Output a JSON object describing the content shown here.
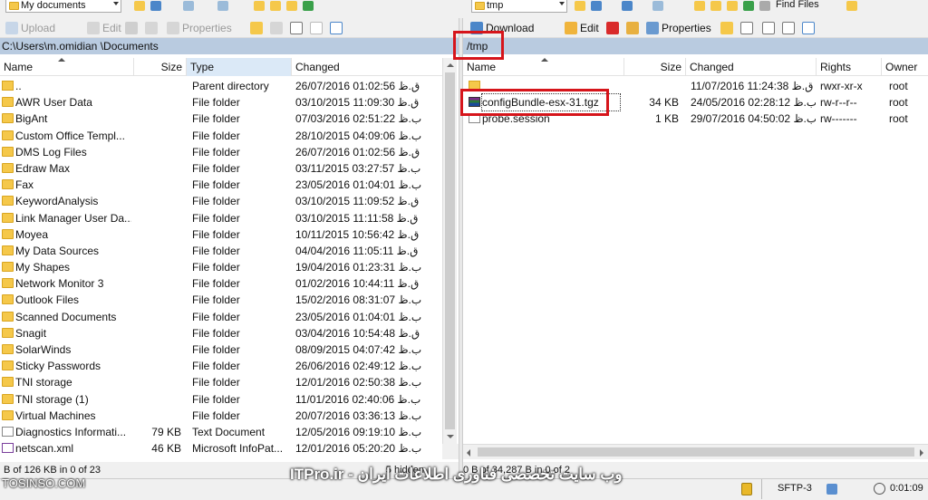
{
  "left_panel": {
    "drive_combo": "My documents",
    "toolbar": {
      "upload": "Upload",
      "edit": "Edit",
      "properties": "Properties"
    },
    "path": "C:\\Users\\m.omidian        \\Documents",
    "columns": {
      "name": "Name",
      "size": "Size",
      "type": "Type",
      "changed": "Changed"
    },
    "rows": [
      {
        "name": "..",
        "size": "",
        "type": "Parent directory",
        "changed": "26/07/2016 01:02:56 ق.ظ",
        "icon": "up-icon"
      },
      {
        "name": "AWR User Data",
        "size": "",
        "type": "File folder",
        "changed": "03/10/2015 11:09:30 ق.ظ",
        "icon": "folder-icon"
      },
      {
        "name": "BigAnt",
        "size": "",
        "type": "File folder",
        "changed": "07/03/2016 02:51:22 ب.ظ",
        "icon": "folder-icon"
      },
      {
        "name": "Custom Office Templ...",
        "size": "",
        "type": "File folder",
        "changed": "28/10/2015 04:09:06 ب.ظ",
        "icon": "folder-icon"
      },
      {
        "name": "DMS Log Files",
        "size": "",
        "type": "File folder",
        "changed": "26/07/2016 01:02:56 ق.ظ",
        "icon": "folder-icon"
      },
      {
        "name": "Edraw Max",
        "size": "",
        "type": "File folder",
        "changed": "03/11/2015 03:27:57 ب.ظ",
        "icon": "folder-icon"
      },
      {
        "name": "Fax",
        "size": "",
        "type": "File folder",
        "changed": "23/05/2016 01:04:01 ب.ظ",
        "icon": "folder-icon"
      },
      {
        "name": "KeywordAnalysis",
        "size": "",
        "type": "File folder",
        "changed": "03/10/2015 11:09:52 ق.ظ",
        "icon": "folder-icon"
      },
      {
        "name": "Link Manager User Da...",
        "size": "",
        "type": "File folder",
        "changed": "03/10/2015 11:11:58 ق.ظ",
        "icon": "folder-icon"
      },
      {
        "name": "Moyea",
        "size": "",
        "type": "File folder",
        "changed": "10/11/2015 10:56:42 ق.ظ",
        "icon": "folder-icon"
      },
      {
        "name": "My Data Sources",
        "size": "",
        "type": "File folder",
        "changed": "04/04/2016 11:05:11 ق.ظ",
        "icon": "folder-icon"
      },
      {
        "name": "My Shapes",
        "size": "",
        "type": "File folder",
        "changed": "19/04/2016 01:23:31 ب.ظ",
        "icon": "folder-icon"
      },
      {
        "name": "Network Monitor 3",
        "size": "",
        "type": "File folder",
        "changed": "01/02/2016 10:44:11 ق.ظ",
        "icon": "folder-icon"
      },
      {
        "name": "Outlook Files",
        "size": "",
        "type": "File folder",
        "changed": "15/02/2016 08:31:07 ب.ظ",
        "icon": "folder-icon"
      },
      {
        "name": "Scanned Documents",
        "size": "",
        "type": "File folder",
        "changed": "23/05/2016 01:04:01 ب.ظ",
        "icon": "folder-icon"
      },
      {
        "name": "Snagit",
        "size": "",
        "type": "File folder",
        "changed": "03/04/2016 10:54:48 ق.ظ",
        "icon": "folder-icon"
      },
      {
        "name": "SolarWinds",
        "size": "",
        "type": "File folder",
        "changed": "08/09/2015 04:07:42 ب.ظ",
        "icon": "folder-icon"
      },
      {
        "name": "Sticky Passwords",
        "size": "",
        "type": "File folder",
        "changed": "26/06/2016 02:49:12 ب.ظ",
        "icon": "folder-icon"
      },
      {
        "name": "TNI storage",
        "size": "",
        "type": "File folder",
        "changed": "12/01/2016 02:50:38 ب.ظ",
        "icon": "folder-icon"
      },
      {
        "name": "TNI storage (1)",
        "size": "",
        "type": "File folder",
        "changed": "11/01/2016 02:40:06 ب.ظ",
        "icon": "folder-icon"
      },
      {
        "name": "Virtual Machines",
        "size": "",
        "type": "File folder",
        "changed": "20/07/2016 03:36:13 ب.ظ",
        "icon": "folder-icon"
      },
      {
        "name": "Diagnostics Informati...",
        "size": "79 KB",
        "type": "Text Document",
        "changed": "12/05/2016 09:19:10 ب.ظ",
        "icon": "file-icon"
      },
      {
        "name": "netscan.xml",
        "size": "46 KB",
        "type": "Microsoft InfoPat...",
        "changed": "12/01/2016 05:20:20 ب.ظ",
        "icon": "xml-file-icon"
      }
    ],
    "status": "B of 126 KB in 0 of 23",
    "hidden": "5 hidden"
  },
  "right_panel": {
    "drive_combo": "tmp",
    "toolbar": {
      "download": "Download",
      "edit": "Edit",
      "properties": "Properties"
    },
    "find_files": "Find Files",
    "path": "/tmp",
    "columns": {
      "name": "Name",
      "size": "Size",
      "changed": "Changed",
      "rights": "Rights",
      "owner": "Owner"
    },
    "rows": [
      {
        "name": "",
        "size": "",
        "changed": "11/07/2016 11:24:38 ق.ظ",
        "rights": "rwxr-xr-x",
        "owner": "root",
        "icon": "up-icon"
      },
      {
        "name": "configBundle-esx-31.tgz",
        "size": "34 KB",
        "changed": "24/05/2016 02:28:12 ب.ظ",
        "rights": "rw-r--r--",
        "owner": "root",
        "icon": "archive-icon"
      },
      {
        "name": "probe.session",
        "size": "1 KB",
        "changed": "29/07/2016 04:50:02 ب.ظ",
        "rights": "rw-------",
        "owner": "root",
        "icon": "file-icon"
      }
    ],
    "status": "0 B of 34,287 B in 0 of 2"
  },
  "bottom": {
    "protocol": "SFTP-3",
    "timer": "0:01:09"
  },
  "watermark": {
    "site": "ITPro.ir - وب سایت تخصصی فناوری اطلاعات ایران",
    "tosinso": "TOSINSO.COM"
  },
  "colors": {
    "highlight": "#d6151b",
    "path_bg": "#b9cbe0",
    "sorted_header": "#dbe9f7"
  }
}
